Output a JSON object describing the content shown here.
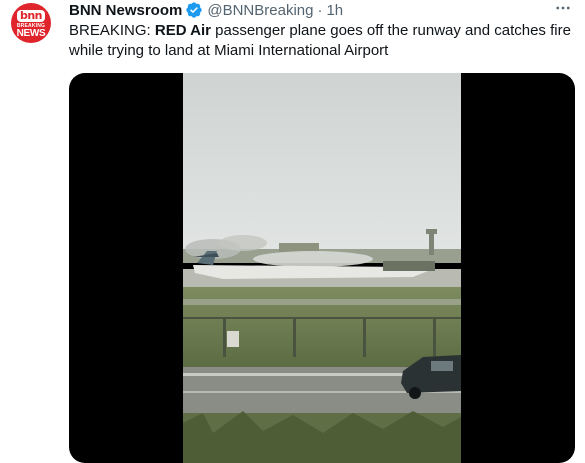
{
  "account": {
    "display_name": "BNN Newsroom",
    "handle": "@BNNBreaking",
    "separator": "·",
    "time": "1h",
    "verified": true,
    "avatar": {
      "logo_top": "bnn",
      "logo_mid": "BREAKING",
      "logo_bot": "NEWS",
      "background": "#e0242b"
    }
  },
  "tweet": {
    "text_prefix": "BREAKING: ",
    "text_bold": "RED Air",
    "text_rest": " passenger plane goes off the runway and catches fire while trying to land at Miami International Airport"
  },
  "icons": {
    "verified": "verified-badge-icon",
    "more": "more-options-icon"
  },
  "colors": {
    "verified_blue": "#1d9bf0",
    "secondary_text": "#536471",
    "primary_text": "#0f1419",
    "media_background": "#000000"
  }
}
